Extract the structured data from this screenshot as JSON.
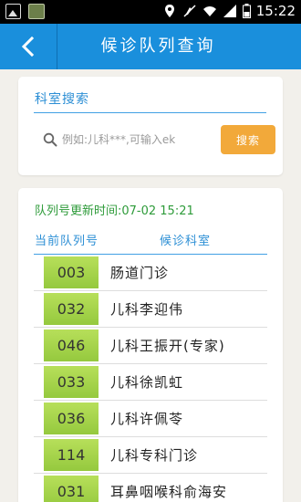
{
  "status_bar": {
    "time": "15:22",
    "icons": [
      "image-icon",
      "app-icon",
      "location-icon",
      "mute-icon",
      "wifi-icon",
      "signal-icon",
      "battery-icon"
    ]
  },
  "header": {
    "title": "候诊队列查询",
    "back_icon": "chevron-left-icon",
    "color": "#1a8fdc"
  },
  "search": {
    "section_label": "科室搜索",
    "placeholder": "例如:儿科***,可输入ek",
    "value": "",
    "button_label": "搜索",
    "button_color": "#f2a93a"
  },
  "queue": {
    "updated_text": "队列号更新时间:07-02 15:21",
    "col_number": "当前队列号",
    "col_dept": "候诊科室",
    "rows": [
      {
        "number": "003",
        "dept": "肠道门诊"
      },
      {
        "number": "032",
        "dept": "儿科李迎伟"
      },
      {
        "number": "046",
        "dept": "儿科王振开(专家)"
      },
      {
        "number": "033",
        "dept": "儿科徐凯虹"
      },
      {
        "number": "036",
        "dept": "儿科许佩苓"
      },
      {
        "number": "114",
        "dept": "儿科专科门诊"
      },
      {
        "number": "031",
        "dept": "耳鼻咽喉科俞海安"
      }
    ],
    "number_bg": "#a6d44b",
    "updated_color": "#2e9b3a",
    "accent_color": "#2d8fd5"
  }
}
